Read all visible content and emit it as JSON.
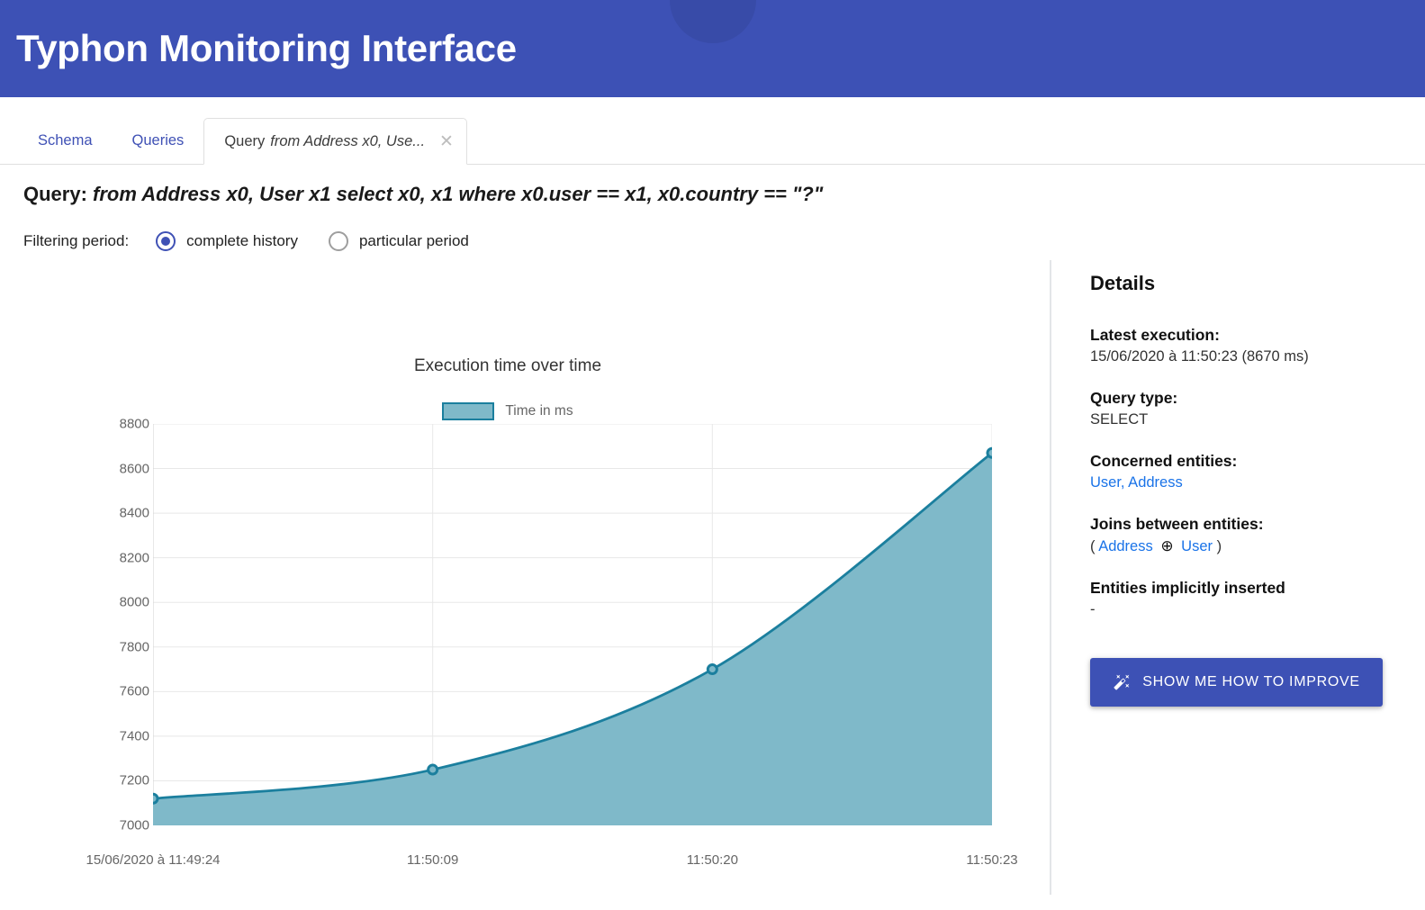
{
  "app": {
    "title": "Typhon Monitoring Interface",
    "header_color": "#3d51b5"
  },
  "tabs": [
    {
      "label": "Schema",
      "name": "tab-schema",
      "active": false
    },
    {
      "label": "Queries",
      "name": "tab-queries",
      "active": false
    }
  ],
  "active_tab": {
    "prefix": "Query",
    "query": "from Address x0, Use...",
    "close_icon": "✕"
  },
  "query_header": {
    "label": "Query:",
    "text": "from Address x0, User x1 select x0, x1 where x0.user == x1, x0.country == \"?\""
  },
  "filter": {
    "label": "Filtering period:",
    "options": [
      {
        "label": "complete history",
        "checked": true
      },
      {
        "label": "particular period",
        "checked": false
      }
    ]
  },
  "details": {
    "title": "Details",
    "latest_execution_label": "Latest execution:",
    "latest_execution_value": "15/06/2020 à 11:50:23 (8670 ms)",
    "query_type_label": "Query type:",
    "query_type_value": "SELECT",
    "concerned_entities_label": "Concerned entities:",
    "concerned_entities_value": "User, Address",
    "joins_label": "Joins between entities:",
    "joins_open": "(",
    "joins_left": "Address",
    "joins_symbol": "⊕",
    "joins_right": "User",
    "joins_close": ")",
    "implicit_label": "Entities implicitly inserted",
    "implicit_value": "-",
    "improve_button": "SHOW ME HOW TO IMPROVE",
    "improve_icon": "magic-wand-icon",
    "link_color": "#1a73e8"
  },
  "chart_data": {
    "type": "area",
    "title": "Execution time over time",
    "xlabel": "",
    "ylabel": "",
    "legend": [
      "Time in ms"
    ],
    "legend_position": "top-center",
    "grid": true,
    "line_color": "#1b7f9e",
    "fill_color": "#7fb9c9",
    "categories": [
      "15/06/2020 à 11:49:24",
      "11:50:09",
      "11:50:20",
      "11:50:23"
    ],
    "series": [
      {
        "name": "Time in ms",
        "values": [
          7120,
          7250,
          7700,
          8670
        ]
      }
    ],
    "ylim": [
      7000,
      8800
    ],
    "ytick_step": 200,
    "yticks": [
      7000,
      7200,
      7400,
      7600,
      7800,
      8000,
      8200,
      8400,
      8600,
      8800
    ]
  }
}
